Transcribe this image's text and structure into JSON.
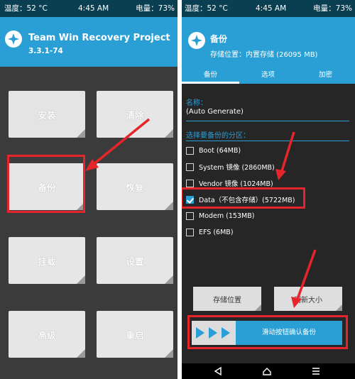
{
  "status": {
    "temp": "温度：52 °C",
    "time": "4:45 AM",
    "battery": "电量：73%"
  },
  "left": {
    "title": "Team Win Recovery Project",
    "version": "3.3.1-74",
    "tiles": [
      "安装",
      "清除",
      "备份",
      "恢复",
      "挂载",
      "设置",
      "高级",
      "重启"
    ]
  },
  "right": {
    "title": "备份",
    "storage": "存储位置：内置存储 (26095 MB)",
    "tabs": [
      "备份",
      "选项",
      "加密"
    ],
    "name_label": "名称：",
    "name_value": "(Auto Generate)",
    "partition_label": "选择要备份的分区：",
    "partitions": [
      {
        "label": "Boot (64MB)",
        "checked": false
      },
      {
        "label": "System 镜像 (2860MB)",
        "checked": false
      },
      {
        "label": "Vendor 镜像 (1024MB)",
        "checked": false
      },
      {
        "label": "Data（不包含存储）(5722MB)",
        "checked": true
      },
      {
        "label": "Modem (153MB)",
        "checked": false
      },
      {
        "label": "EFS (6MB)",
        "checked": false
      }
    ],
    "btn_storage": "存储位置",
    "btn_refresh": "刷新大小",
    "slider_text": "滑动按钮确认备份"
  },
  "colors": {
    "accent": "#2a9fd6",
    "status_bar": "#0a3f52",
    "annotation": "#e5252a",
    "bg": "#3b3b3b"
  },
  "icons": {
    "logo": "twrp-logo-icon",
    "back": "back-triangle-icon",
    "home": "home-icon",
    "menu": "menu-icon"
  }
}
